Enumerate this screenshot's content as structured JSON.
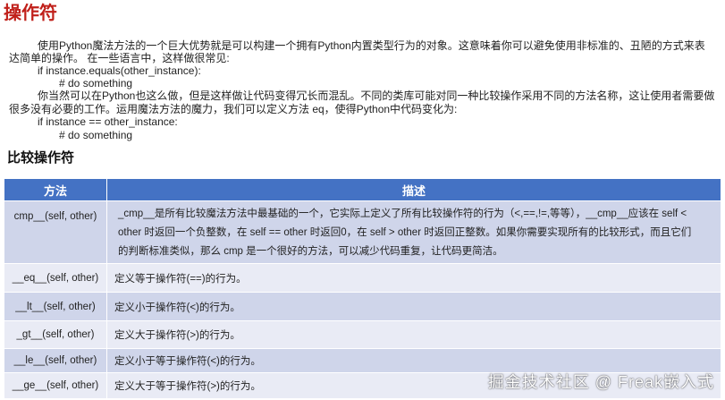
{
  "title": "操作符",
  "intro": {
    "line1": "使用Python魔法方法的一个巨大优势就是可以构建一个拥有Python内置类型行为的对象。这意味着你可以避免使用非标准的、丑陋的方式来表",
    "line2": "达简单的操作。 在一些语言中，这样做很常见:",
    "code1": "if instance.equals(other_instance):",
    "code2": "# do something",
    "line3": "你当然可以在Python也这么做，但是这样做让代码变得冗长而混乱。不同的类库可能对同一种比较操作采用不同的方法名称，这让使用者需要做",
    "line4": "很多没有必要的工作。运用魔法方法的魔力，我们可以定义方法 eq，使得Python中代码变化为:",
    "code3": "if instance == other_instance:",
    "code4": "# do something"
  },
  "section_title": "比较操作符",
  "table": {
    "headers": [
      "方法",
      "描述"
    ],
    "rows": [
      {
        "method": "cmp__(self, other)",
        "desc_lines": [
          "_cmp__是所有比较魔法方法中最基础的一个，它实际上定义了所有比较操作符的行为（<,==,!=,等等），__cmp__应该在 self <",
          "other 时返回一个负整数，在 self == other 时返回0，在 self > other 时返回正整数。如果你需要实现所有的比较形式，而且它们",
          "的判断标准类似，那么 cmp 是一个很好的方法，可以减少代码重复，让代码更简洁。"
        ]
      },
      {
        "method": "__eq__(self, other)",
        "desc_lines": [
          "定义等于操作符(==)的行为。"
        ]
      },
      {
        "method": "__lt__(self, other)",
        "desc_lines": [
          "定义小于操作符(<)的行为。"
        ]
      },
      {
        "method": "_gt__(self, other)",
        "desc_lines": [
          "定义大于操作符(>)的行为。"
        ]
      },
      {
        "method": "__le__(self, other)",
        "desc_lines": [
          "定义小于等于操作符(<)的行为。"
        ]
      },
      {
        "method": "__ge__(self, other)",
        "desc_lines": [
          "定义大于等于操作符(>)的行为。"
        ]
      }
    ]
  },
  "watermark": "掘金技术社区 @ Freak嵌入式"
}
